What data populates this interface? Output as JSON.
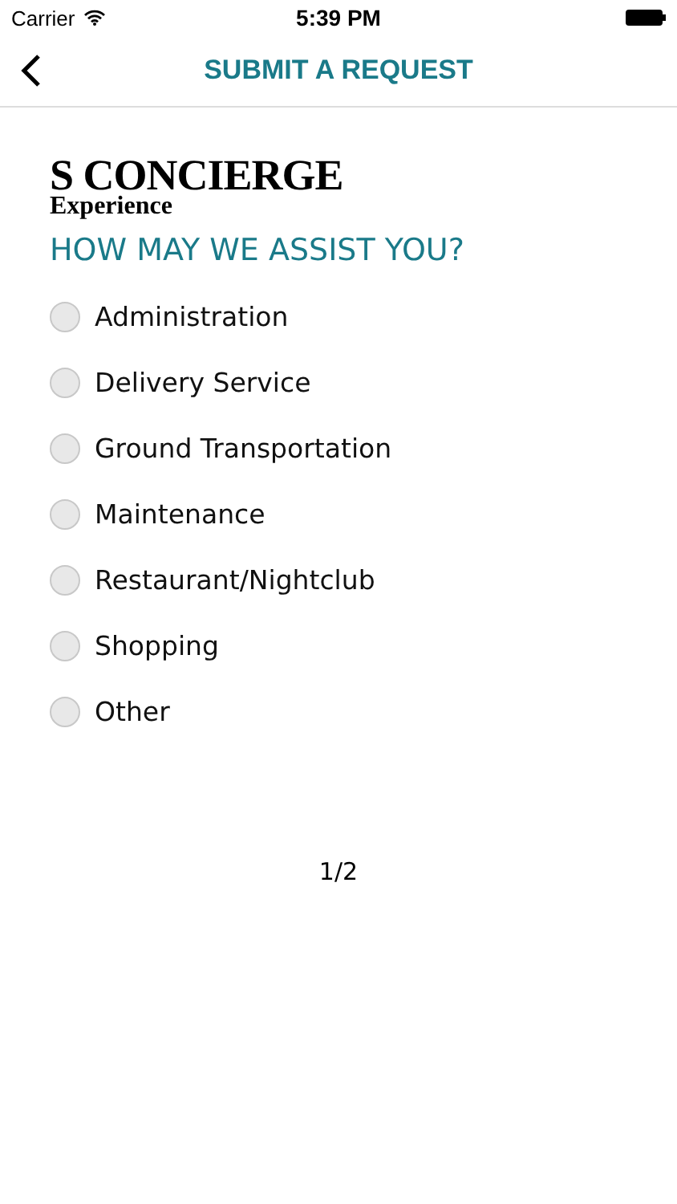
{
  "status_bar": {
    "carrier": "Carrier",
    "time": "5:39 PM"
  },
  "nav": {
    "title": "SUBMIT A REQUEST"
  },
  "logo": {
    "title": "S CONCIERGE",
    "subtitle": "Experience"
  },
  "question": "HOW MAY WE ASSIST YOU?",
  "options": [
    {
      "label": "Administration",
      "selected": false
    },
    {
      "label": "Delivery Service",
      "selected": false
    },
    {
      "label": "Ground Transportation",
      "selected": false
    },
    {
      "label": "Maintenance",
      "selected": false
    },
    {
      "label": "Restaurant/Nightclub",
      "selected": false
    },
    {
      "label": "Shopping",
      "selected": false
    },
    {
      "label": "Other",
      "selected": false
    }
  ],
  "page_indicator": "1/2"
}
